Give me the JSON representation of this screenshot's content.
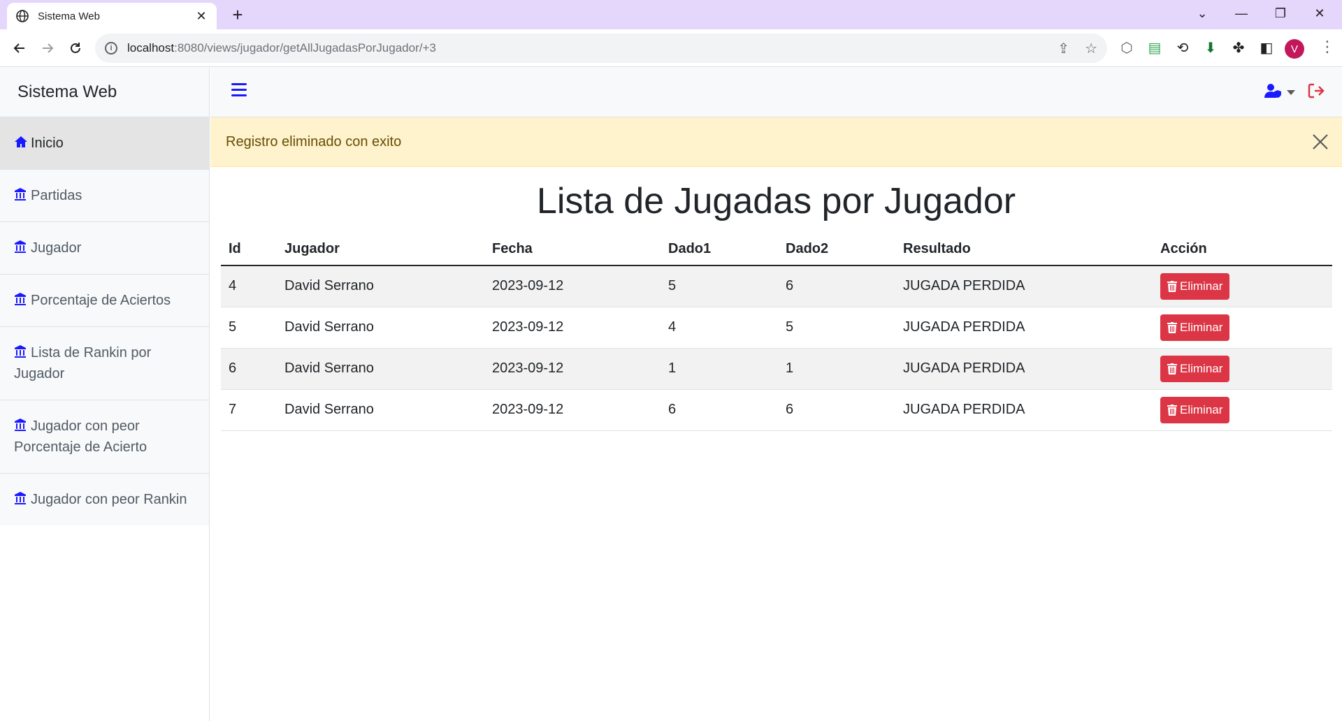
{
  "browser": {
    "tab_title": "Sistema Web",
    "url_host": "localhost",
    "url_path": ":8080/views/jugador/getAllJugadasPorJugador/+3",
    "profile_initial": "V"
  },
  "sidebar": {
    "brand": "Sistema Web",
    "items": [
      {
        "label": "Inicio",
        "icon": "home-icon"
      },
      {
        "label": "Partidas",
        "icon": "building-icon"
      },
      {
        "label": "Jugador",
        "icon": "building-icon"
      },
      {
        "label": "Porcentaje de Aciertos",
        "icon": "building-icon"
      },
      {
        "label": "Lista de Rankin por Jugador",
        "icon": "building-icon"
      },
      {
        "label": "Jugador con peor Porcentaje de Acierto",
        "icon": "building-icon"
      },
      {
        "label": "Jugador con peor Rankin",
        "icon": "building-icon"
      }
    ]
  },
  "alert": {
    "message": "Registro eliminado con exito"
  },
  "page": {
    "title": "Lista de Jugadas por Jugador"
  },
  "table": {
    "headers": [
      "Id",
      "Jugador",
      "Fecha",
      "Dado1",
      "Dado2",
      "Resultado",
      "Acción"
    ],
    "rows": [
      {
        "id": "4",
        "jugador": "David Serrano",
        "fecha": "2023-09-12",
        "dado1": "5",
        "dado2": "6",
        "resultado": "JUGADA PERDIDA",
        "accion": "Eliminar"
      },
      {
        "id": "5",
        "jugador": "David Serrano",
        "fecha": "2023-09-12",
        "dado1": "4",
        "dado2": "5",
        "resultado": "JUGADA PERDIDA",
        "accion": "Eliminar"
      },
      {
        "id": "6",
        "jugador": "David Serrano",
        "fecha": "2023-09-12",
        "dado1": "1",
        "dado2": "1",
        "resultado": "JUGADA PERDIDA",
        "accion": "Eliminar"
      },
      {
        "id": "7",
        "jugador": "David Serrano",
        "fecha": "2023-09-12",
        "dado1": "6",
        "dado2": "6",
        "resultado": "JUGADA PERDIDA",
        "accion": "Eliminar"
      }
    ]
  },
  "colors": {
    "accent_blue": "#1a1aff",
    "danger": "#dc3545",
    "alert_bg": "#fff3cd"
  }
}
